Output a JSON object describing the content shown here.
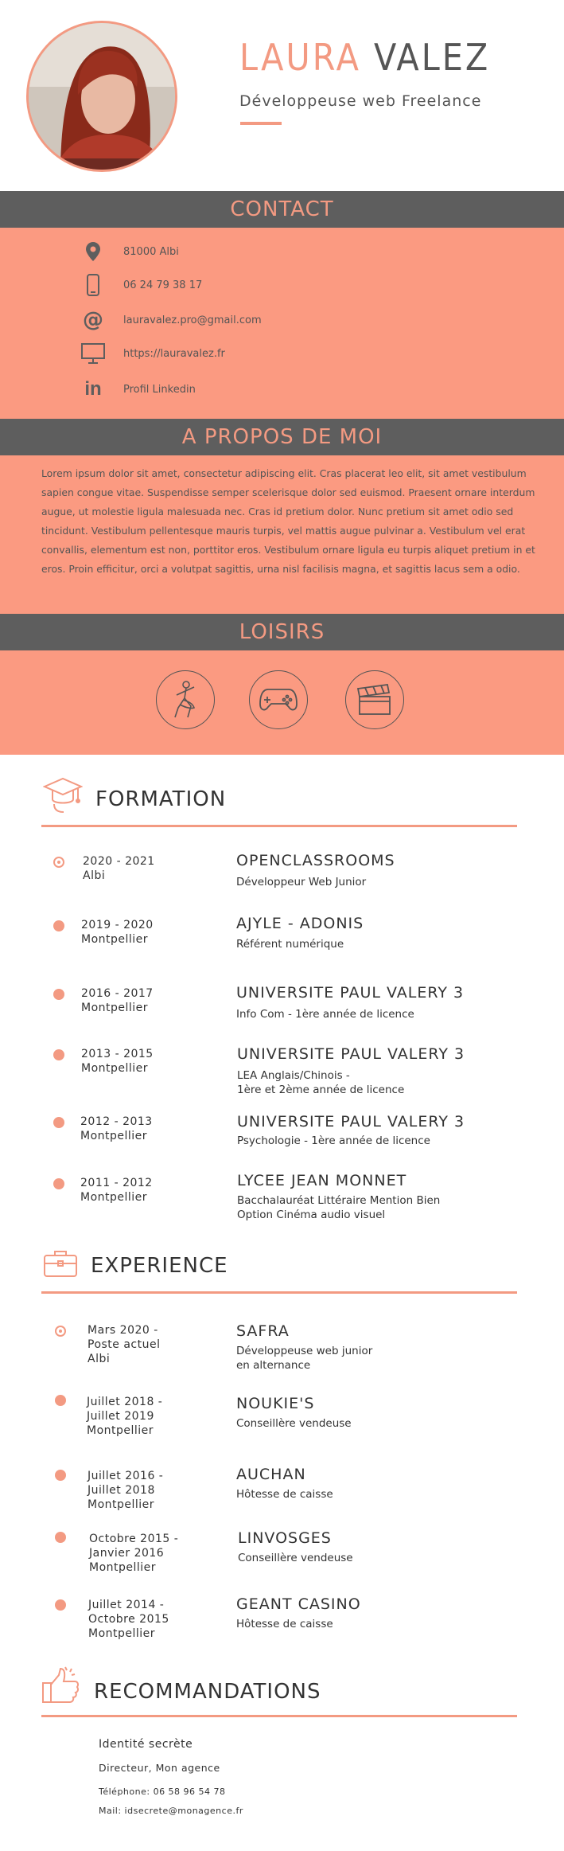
{
  "header": {
    "first_name": "LAURA",
    "last_name": "VALEZ",
    "job_title": "Développeuse web Freelance"
  },
  "contact": {
    "title": "CONTACT",
    "items": [
      {
        "icon": "location-pin-icon",
        "text": "81000 Albi"
      },
      {
        "icon": "smartphone-icon",
        "text": "06 24 79 38 17"
      },
      {
        "icon": "at-sign-icon",
        "text": "lauravalez.pro@gmail.com"
      },
      {
        "icon": "monitor-icon",
        "text": "https://lauravalez.fr"
      },
      {
        "icon": "linkedin-icon",
        "text": "Profil Linkedin"
      }
    ]
  },
  "about": {
    "title": "A PROPOS DE MOI",
    "text": "Lorem ipsum dolor sit amet, consectetur adipiscing elit. Cras placerat leo elit, sit amet vestibulum sapien congue vitae. Suspendisse semper scelerisque dolor sed euismod. Praesent ornare interdum augue, ut molestie ligula malesuada nec. Cras id pretium dolor. Nunc pretium sit amet odio sed tincidunt. Vestibulum pellentesque mauris turpis, vel mattis augue pulvinar a. Vestibulum vel erat convallis, elementum est non, porttitor eros. Vestibulum ornare ligula eu turpis aliquet pretium in et eros. Proin efficitur, orci a volutpat sagittis, urna nisl facilisis magna, et sagittis lacus sem a odio."
  },
  "hobbies": {
    "title": "LOISIRS",
    "icons": [
      "dancer-icon",
      "gamepad-icon",
      "clapperboard-icon"
    ]
  },
  "formation": {
    "title": "FORMATION",
    "items": [
      {
        "date": "2020 - 2021\nAlbi",
        "school": "OPENCLASSROOMS",
        "detail": "Développeur Web Junior"
      },
      {
        "date": "2019 - 2020\nMontpellier",
        "school": "AJYLE - ADONIS",
        "detail": "Référent numérique"
      },
      {
        "date": "2016 - 2017\nMontpellier",
        "school": "UNIVERSITE PAUL VALERY 3",
        "detail": "Info Com - 1ère année de licence"
      },
      {
        "date": "2013 - 2015\nMontpellier",
        "school": "UNIVERSITE PAUL VALERY 3",
        "detail": "LEA Anglais/Chinois -\n1ère et 2ème année de licence"
      },
      {
        "date": "2012 - 2013\nMontpellier",
        "school": "UNIVERSITE PAUL VALERY 3",
        "detail": "Psychologie - 1ère année de licence"
      },
      {
        "date": "2011 - 2012\nMontpellier",
        "school": "LYCEE JEAN MONNET",
        "detail": "Bacchalauréat Littéraire Mention Bien\nOption Cinéma audio visuel"
      }
    ]
  },
  "experience": {
    "title": "EXPERIENCE",
    "items": [
      {
        "date": "Mars 2020 -\nPoste actuel\nAlbi",
        "company": "SAFRA",
        "detail": "Développeuse web junior\nen alternance"
      },
      {
        "date": "Juillet 2018 -\nJuillet 2019\nMontpellier",
        "company": "NOUKIE'S",
        "detail": "Conseillère vendeuse"
      },
      {
        "date": "Juillet 2016 -\nJuillet 2018\nMontpellier",
        "company": "AUCHAN",
        "detail": "Hôtesse de caisse"
      },
      {
        "date": "Octobre 2015 -\nJanvier 2016\nMontpellier",
        "company": "LINVOSGES",
        "detail": "Conseillère vendeuse"
      },
      {
        "date": "Juillet 2014 -\nOctobre 2015\nMontpellier",
        "company": "GEANT CASINO",
        "detail": "Hôtesse de caisse"
      }
    ]
  },
  "recommendations": {
    "title": "RECOMMANDATIONS",
    "name": "Identité secrète",
    "role": "Directeur, Mon agence",
    "phone": "Téléphone: 06 58 96 54 78",
    "mail": "Mail: idsecrete@monagence.fr"
  },
  "colors": {
    "accent": "#f39a82",
    "band": "#fb9a81",
    "dark": "#5e5e5e"
  }
}
